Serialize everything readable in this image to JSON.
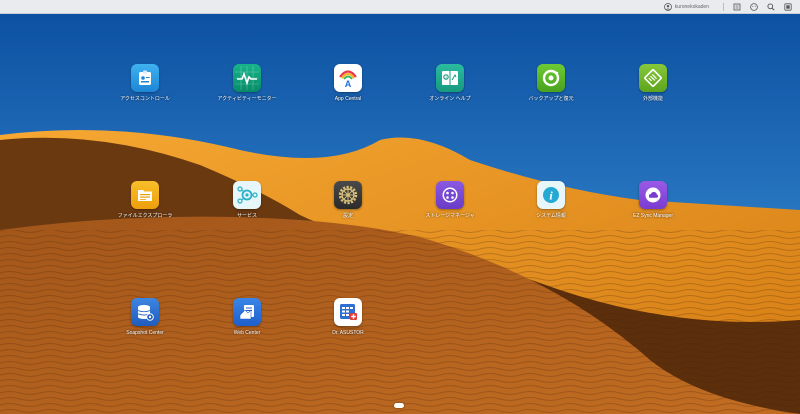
{
  "topbar": {
    "username": "kuronekokaden",
    "icons": [
      "user-icon",
      "notes-icon",
      "smile-icon",
      "search-icon",
      "widget-icon"
    ]
  },
  "apps": [
    {
      "label": "アクセスコントロール",
      "icon": "access-control-icon",
      "color": "#2d9be0"
    },
    {
      "label": "アクティビティーモニター",
      "icon": "activity-monitor-icon",
      "color": "#0da07a"
    },
    {
      "label": "App Central",
      "icon": "app-central-icon",
      "color": "#ffffff"
    },
    {
      "label": "オンライン ヘルプ",
      "icon": "online-help-icon",
      "color": "#22a58c"
    },
    {
      "label": "バックアップと復元",
      "icon": "backup-restore-icon",
      "color": "#5cb82b"
    },
    {
      "label": "外部機能",
      "icon": "external-devices-icon",
      "color": "#71b62a"
    },
    {
      "label": "ファイルエクスプローラ",
      "icon": "file-explorer-icon",
      "color": "#f2a914"
    },
    {
      "label": "サービス",
      "icon": "services-icon",
      "color": "#e7f6fa"
    },
    {
      "label": "設定",
      "icon": "settings-icon",
      "color": "#3a3a3a"
    },
    {
      "label": "ストレージマネージャ",
      "icon": "storage-manager-icon",
      "color": "#7c4bd6"
    },
    {
      "label": "システム情報",
      "icon": "system-info-icon",
      "color": "#e7f6fa"
    },
    {
      "label": "EZ Sync Manager",
      "icon": "ez-sync-icon",
      "color": "#8a4bd6"
    },
    {
      "label": "Snapshot Center",
      "icon": "snapshot-center-icon",
      "color": "#2f6fd2"
    },
    {
      "label": "Web Center",
      "icon": "web-center-icon",
      "color": "#2b6fd8"
    },
    {
      "label": "Dr. ASUSTOR",
      "icon": "dr-asustor-icon",
      "color": "#ffffff"
    }
  ]
}
